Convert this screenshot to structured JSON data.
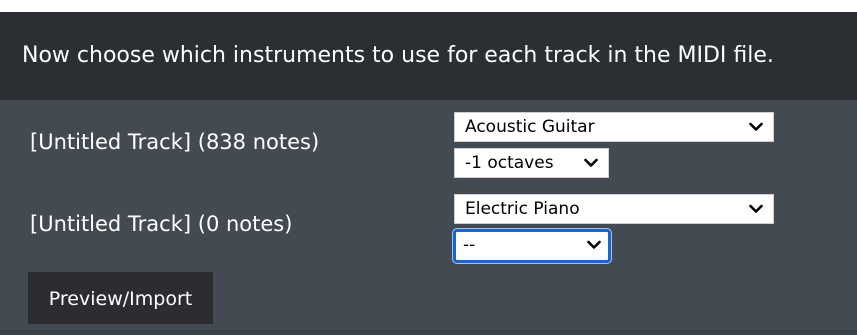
{
  "header": {
    "instruction": "Now choose which instruments to use for each track in the MIDI file."
  },
  "tracks": [
    {
      "label": "[Untitled Track] (838 notes)",
      "instrument": "Acoustic Guitar",
      "octave": "-1 octaves"
    },
    {
      "label": "[Untitled Track] (0 notes)",
      "instrument": "Electric Piano",
      "octave": "--"
    }
  ],
  "actions": {
    "preview_import_label": "Preview/Import"
  },
  "colors": {
    "focus_ring": "#1f64c9",
    "panel_bg": "#444a52",
    "header_bg": "#2b2e33"
  }
}
